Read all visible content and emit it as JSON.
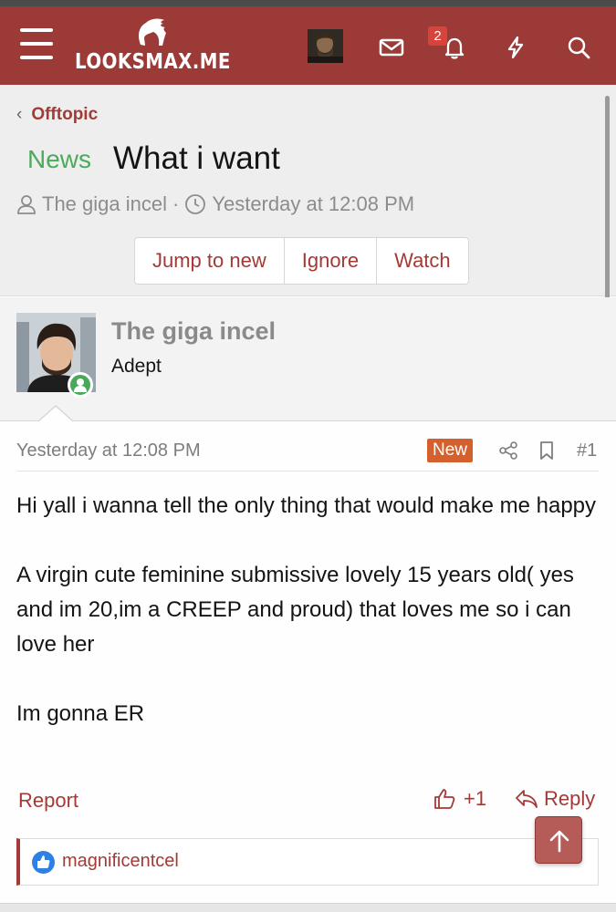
{
  "header": {
    "logo_text": "LOOKSMAX.ME",
    "notification_count": "2",
    "accent_color": "#9b3a36"
  },
  "breadcrumb": {
    "label": "Offtopic"
  },
  "thread": {
    "prefix": "News",
    "title": "What i want",
    "author": "The giga incel",
    "separator": "·",
    "time": "Yesterday at 12:08 PM",
    "buttons": [
      "Jump to new",
      "Ignore",
      "Watch"
    ]
  },
  "post": {
    "username": "The giga incel",
    "role": "Adept",
    "date": "Yesterday at 12:08 PM",
    "new_badge": "New",
    "number": "#1",
    "paragraphs": [
      "Hi yall i wanna tell the only thing that would make me happy",
      "A virgin cute feminine submissive lovely 15 years old( yes and im 20,im a CREEP and proud) that loves me so i can love her",
      "Im gonna ER"
    ],
    "report_label": "Report",
    "like_count": "+1",
    "reply_label": "Reply",
    "reaction_user": "magnificentcel"
  },
  "icons": {
    "menu": "hamburger-icon",
    "mail": "envelope-icon",
    "bell": "bell-icon",
    "bolt": "lightning-icon",
    "search": "search-icon",
    "share": "share-icon",
    "bookmark": "bookmark-icon",
    "like": "thumbs-up-icon",
    "reply": "reply-icon",
    "top": "arrow-up-icon"
  }
}
